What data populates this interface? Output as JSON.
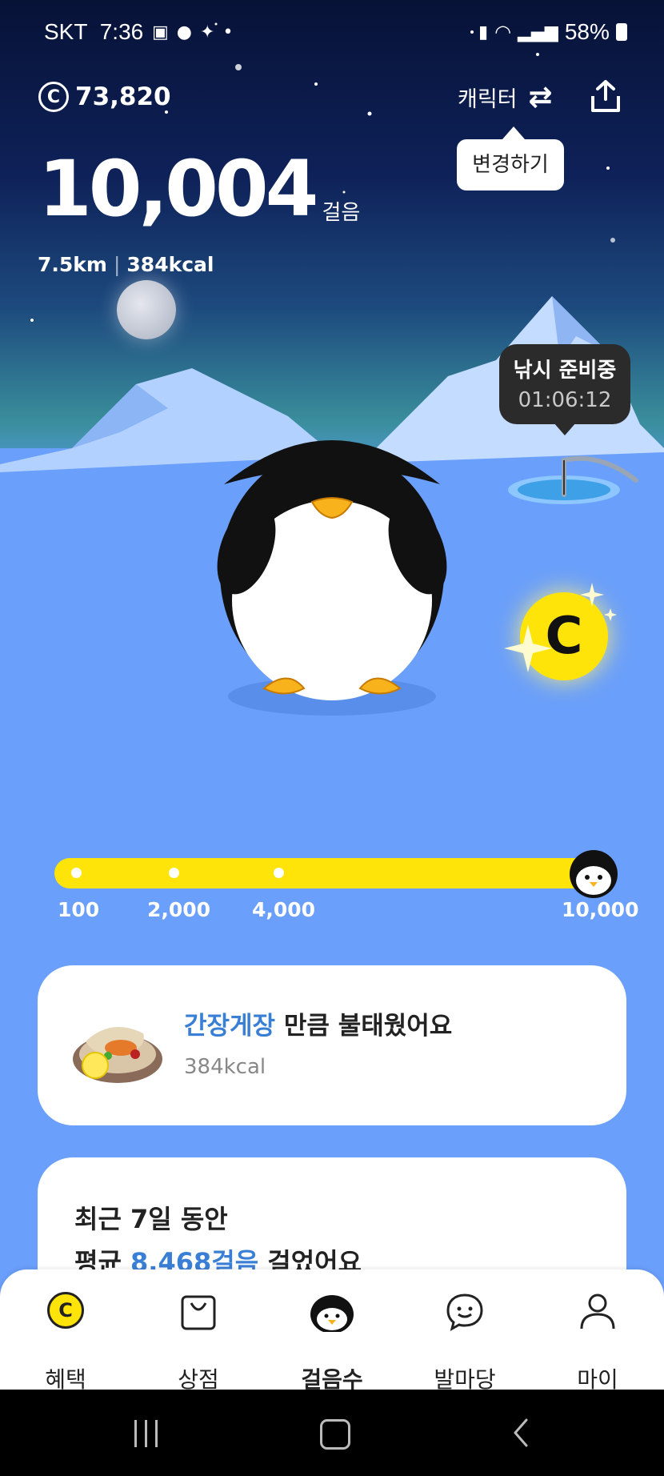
{
  "status_bar": {
    "carrier": "SKT",
    "time": "7:36",
    "battery": "58%"
  },
  "header": {
    "coins": "73,820",
    "character_label": "캐릭터",
    "change_tooltip": "변경하기"
  },
  "steps": {
    "count": "10,004",
    "unit": "걸음",
    "distance": "7.5km",
    "separator": "|",
    "kcal": "384kcal"
  },
  "fishing": {
    "status": "낚시 준비중",
    "timer": "01:06:12"
  },
  "progress": {
    "ticks": [
      "100",
      "2,000",
      "4,000",
      "10,000"
    ],
    "fraction": 1.0
  },
  "burn_card": {
    "food": "간장게장",
    "suffix": " 만큼 불태웠어요",
    "kcal": "384kcal"
  },
  "weekly_card": {
    "line1": "최근 7일 동안",
    "prefix": "평균 ",
    "avg": "8,468걸음",
    "suffix": " 걸었어요"
  },
  "nav": [
    {
      "label": "혜택",
      "icon": "coin-icon"
    },
    {
      "label": "상점",
      "icon": "shopping-bag-icon"
    },
    {
      "label": "걸음수",
      "icon": "penguin-icon"
    },
    {
      "label": "발마당",
      "icon": "chat-smile-icon"
    },
    {
      "label": "마이",
      "icon": "person-icon"
    }
  ],
  "colors": {
    "accent_blue": "#3a7fd6",
    "progress_yellow": "#ffe40a",
    "ground": "#6a9ffb"
  }
}
